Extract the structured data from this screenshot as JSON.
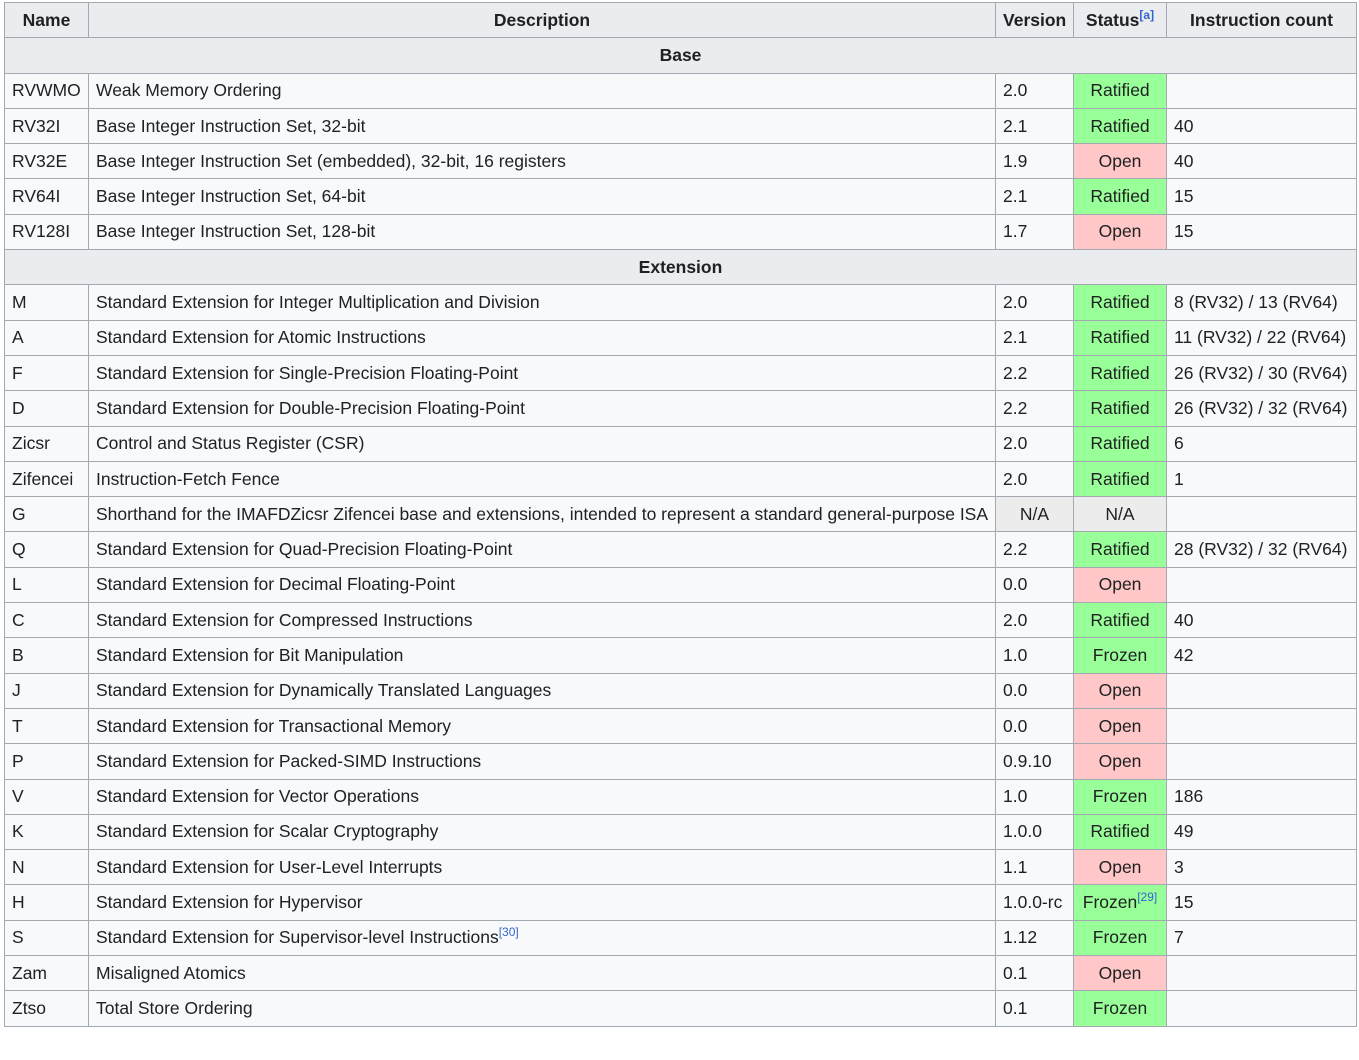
{
  "headers": {
    "name": "Name",
    "description": "Description",
    "version": "Version",
    "status": "Status",
    "status_note": "[a]",
    "count": "Instruction count"
  },
  "sections": [
    {
      "title": "Base",
      "rows": [
        {
          "name": "RVWMO",
          "desc": "Weak Memory Ordering",
          "desc_ref": "",
          "version": "2.0",
          "status": "Ratified",
          "status_ref": "",
          "count": ""
        },
        {
          "name": "RV32I",
          "desc": "Base Integer Instruction Set, 32-bit",
          "desc_ref": "",
          "version": "2.1",
          "status": "Ratified",
          "status_ref": "",
          "count": "40"
        },
        {
          "name": "RV32E",
          "desc": "Base Integer Instruction Set (embedded), 32-bit, 16 registers",
          "desc_ref": "",
          "version": "1.9",
          "status": "Open",
          "status_ref": "",
          "count": "40"
        },
        {
          "name": "RV64I",
          "desc": "Base Integer Instruction Set, 64-bit",
          "desc_ref": "",
          "version": "2.1",
          "status": "Ratified",
          "status_ref": "",
          "count": "15"
        },
        {
          "name": "RV128I",
          "desc": "Base Integer Instruction Set, 128-bit",
          "desc_ref": "",
          "version": "1.7",
          "status": "Open",
          "status_ref": "",
          "count": "15"
        }
      ]
    },
    {
      "title": "Extension",
      "rows": [
        {
          "name": "M",
          "desc": "Standard Extension for Integer Multiplication and Division",
          "desc_ref": "",
          "version": "2.0",
          "status": "Ratified",
          "status_ref": "",
          "count": "8 (RV32) / 13 (RV64)"
        },
        {
          "name": "A",
          "desc": "Standard Extension for Atomic Instructions",
          "desc_ref": "",
          "version": "2.1",
          "status": "Ratified",
          "status_ref": "",
          "count": "11 (RV32) / 22 (RV64)"
        },
        {
          "name": "F",
          "desc": "Standard Extension for Single-Precision Floating-Point",
          "desc_ref": "",
          "version": "2.2",
          "status": "Ratified",
          "status_ref": "",
          "count": "26 (RV32) / 30 (RV64)"
        },
        {
          "name": "D",
          "desc": "Standard Extension for Double-Precision Floating-Point",
          "desc_ref": "",
          "version": "2.2",
          "status": "Ratified",
          "status_ref": "",
          "count": "26 (RV32) / 32 (RV64)"
        },
        {
          "name": "Zicsr",
          "desc": "Control and Status Register (CSR)",
          "desc_ref": "",
          "version": "2.0",
          "status": "Ratified",
          "status_ref": "",
          "count": "6"
        },
        {
          "name": "Zifencei",
          "desc": "Instruction-Fetch Fence",
          "desc_ref": "",
          "version": "2.0",
          "status": "Ratified",
          "status_ref": "",
          "count": "1"
        },
        {
          "name": "G",
          "desc": "Shorthand for the IMAFDZicsr Zifencei base and extensions, intended to represent a standard general-purpose ISA",
          "desc_ref": "",
          "version": "N/A",
          "status": "N/A",
          "status_ref": "",
          "count": ""
        },
        {
          "name": "Q",
          "desc": "Standard Extension for Quad-Precision Floating-Point",
          "desc_ref": "",
          "version": "2.2",
          "status": "Ratified",
          "status_ref": "",
          "count": "28 (RV32) / 32 (RV64)"
        },
        {
          "name": "L",
          "desc": "Standard Extension for Decimal Floating-Point",
          "desc_ref": "",
          "version": "0.0",
          "status": "Open",
          "status_ref": "",
          "count": ""
        },
        {
          "name": "C",
          "desc": "Standard Extension for Compressed Instructions",
          "desc_ref": "",
          "version": "2.0",
          "status": "Ratified",
          "status_ref": "",
          "count": "40"
        },
        {
          "name": "B",
          "desc": "Standard Extension for Bit Manipulation",
          "desc_ref": "",
          "version": "1.0",
          "status": "Frozen",
          "status_ref": "",
          "count": "42"
        },
        {
          "name": "J",
          "desc": "Standard Extension for Dynamically Translated Languages",
          "desc_ref": "",
          "version": "0.0",
          "status": "Open",
          "status_ref": "",
          "count": ""
        },
        {
          "name": "T",
          "desc": "Standard Extension for Transactional Memory",
          "desc_ref": "",
          "version": "0.0",
          "status": "Open",
          "status_ref": "",
          "count": ""
        },
        {
          "name": "P",
          "desc": "Standard Extension for Packed-SIMD Instructions",
          "desc_ref": "",
          "version": "0.9.10",
          "status": "Open",
          "status_ref": "",
          "count": ""
        },
        {
          "name": "V",
          "desc": "Standard Extension for Vector Operations",
          "desc_ref": "",
          "version": "1.0",
          "status": "Frozen",
          "status_ref": "",
          "count": "186"
        },
        {
          "name": "K",
          "desc": "Standard Extension for Scalar Cryptography",
          "desc_ref": "",
          "version": "1.0.0",
          "status": "Ratified",
          "status_ref": "",
          "count": "49"
        },
        {
          "name": "N",
          "desc": "Standard Extension for User-Level Interrupts",
          "desc_ref": "",
          "version": "1.1",
          "status": "Open",
          "status_ref": "",
          "count": "3"
        },
        {
          "name": "H",
          "desc": "Standard Extension for Hypervisor",
          "desc_ref": "",
          "version": "1.0.0-rc",
          "status": "Frozen",
          "status_ref": "[29]",
          "count": "15"
        },
        {
          "name": "S",
          "desc": "Standard Extension for Supervisor-level Instructions",
          "desc_ref": "[30]",
          "version": "1.12",
          "status": "Frozen",
          "status_ref": "",
          "count": "7"
        },
        {
          "name": "Zam",
          "desc": "Misaligned Atomics",
          "desc_ref": "",
          "version": "0.1",
          "status": "Open",
          "status_ref": "",
          "count": ""
        },
        {
          "name": "Ztso",
          "desc": "Total Store Ordering",
          "desc_ref": "",
          "version": "0.1",
          "status": "Frozen",
          "status_ref": "",
          "count": ""
        }
      ]
    }
  ],
  "colors": {
    "ok": "#99ff99",
    "open": "#ffc7c7",
    "na": "#ececec",
    "border": "#a2a9b1",
    "header_bg": "#eaecf0",
    "cell_bg": "#f8f9fa",
    "link": "#3366cc"
  }
}
